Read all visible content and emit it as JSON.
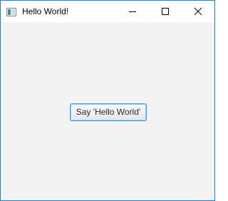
{
  "window": {
    "title": "Hello World!",
    "controls": {
      "minimize_icon": "minimize-icon",
      "maximize_icon": "maximize-icon",
      "close_icon": "close-icon"
    },
    "app_icon": "window-icon"
  },
  "main": {
    "button_label": "Say 'Hello World'"
  },
  "colors": {
    "window_border": "#1f7fd0",
    "client_background": "#f4f3f3",
    "button_focus_border": "#3a97d7"
  }
}
